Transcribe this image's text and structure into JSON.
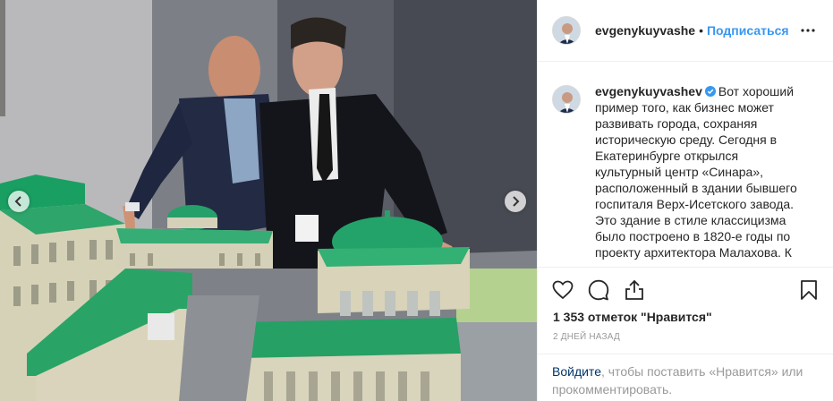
{
  "header": {
    "username": "evgenykuyvashe",
    "separator": "•",
    "follow_label": "Подписаться",
    "more_icon": "more-horizontal-icon"
  },
  "caption": {
    "username": "evgenykuyvashev",
    "verified_icon": "verified-badge-icon",
    "text": "Вот хороший пример того, как бизнес может развивать города, сохраняя историческую среду. Сегодня в Екатеринбурге открылся культурный центр «Синара», расположенный в здании бывшего госпиталя Верх-Исетского завода. Это здание в стиле классицизма было построено в 1820-е годы по проекту архитектора Малахова. К"
  },
  "media": {
    "prev_icon": "chevron-left-icon",
    "next_icon": "chevron-right-icon"
  },
  "actions": {
    "like_icon": "heart-icon",
    "comment_icon": "comment-icon",
    "share_icon": "share-icon",
    "save_icon": "bookmark-icon"
  },
  "likes_text": "1 353 отметок \"Нравится\"",
  "time_text": "2 дней назад",
  "login": {
    "link": "Войдите",
    "rest": ", чтобы поставить «Нравится» или прокомментировать."
  },
  "colors": {
    "link_blue": "#3897f0",
    "dark_link": "#003569",
    "text": "#262626",
    "muted": "#999999",
    "roof_green": "#2f9e6e"
  }
}
